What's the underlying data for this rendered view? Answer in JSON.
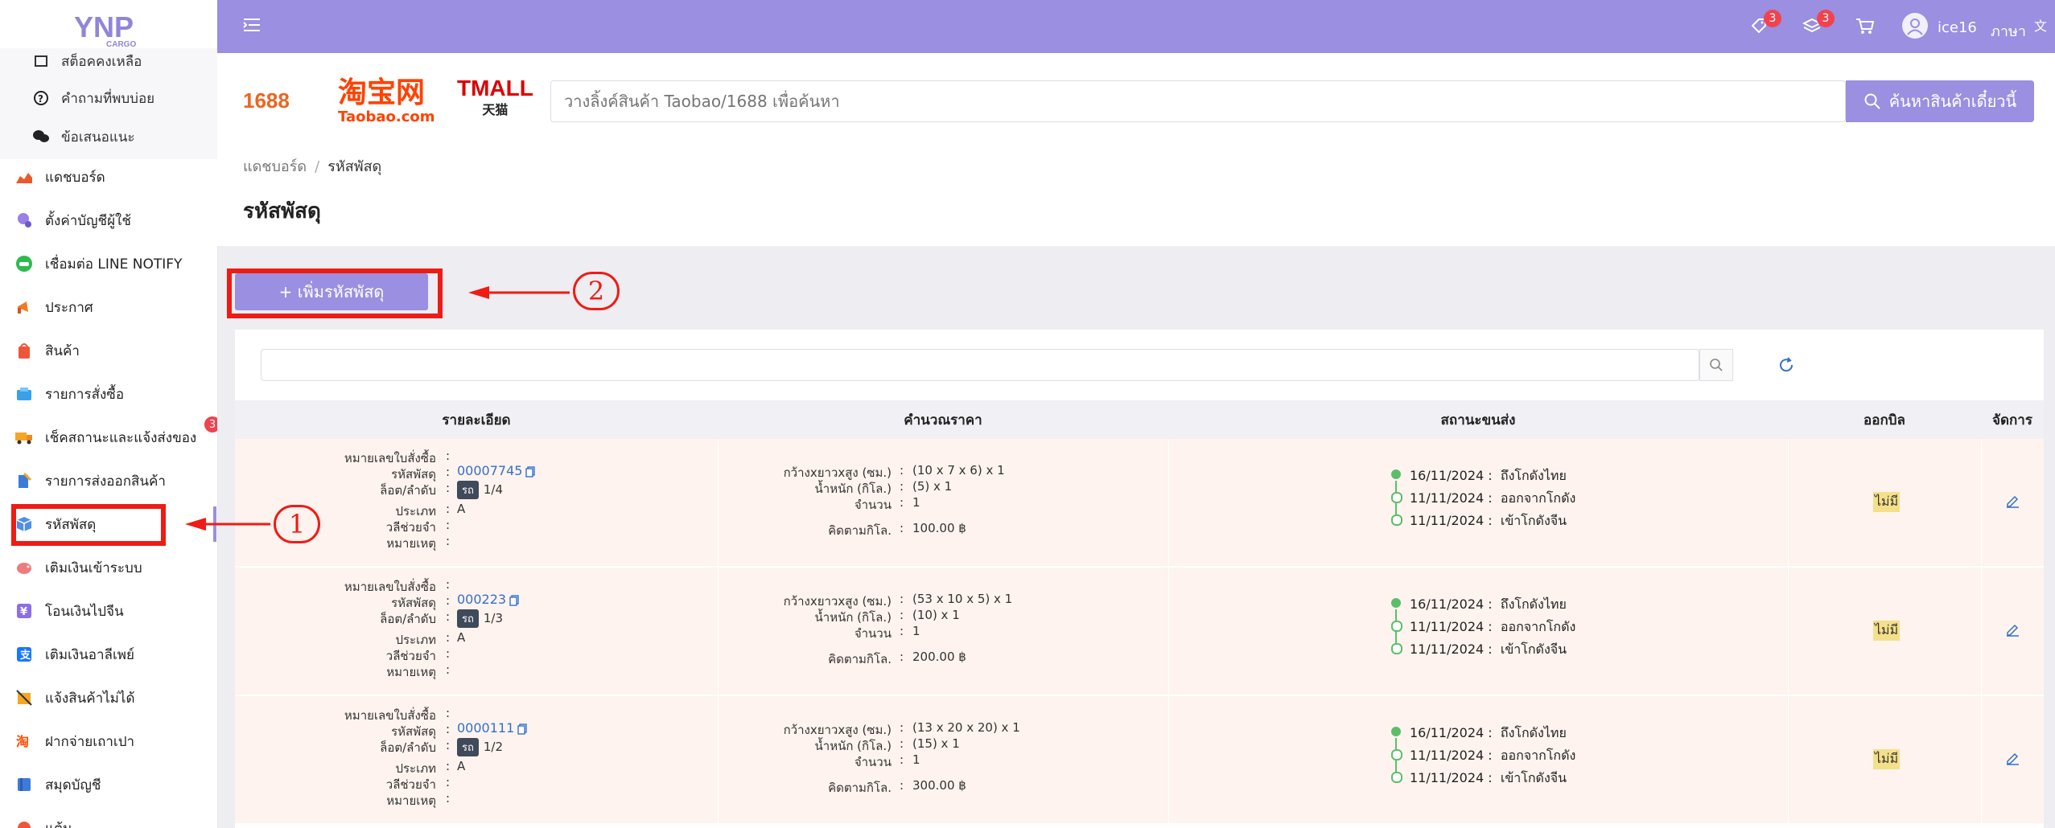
{
  "brand": {
    "logo_text": "YNP",
    "logo_sub": "CARGO"
  },
  "sidebar": {
    "sub_items": [
      {
        "label": "สต็อคคงเหลือ",
        "icon": "stock-icon"
      },
      {
        "label": "คำถามที่พบบ่อย",
        "icon": "question-icon"
      },
      {
        "label": "ข้อเสนอแนะ",
        "icon": "chat-icon"
      }
    ],
    "items": [
      {
        "label": "แดชบอร์ด",
        "icon": "chart-icon"
      },
      {
        "label": "ตั้งค่าบัญชีผู้ใช้",
        "icon": "user-settings-icon"
      },
      {
        "label": "เชื่อมต่อ LINE NOTIFY",
        "icon": "line-icon"
      },
      {
        "label": "ประกาศ",
        "icon": "megaphone-icon"
      },
      {
        "label": "สินค้า",
        "icon": "bag-icon"
      },
      {
        "label": "รายการสั่งซื้อ",
        "icon": "cart-box-icon"
      },
      {
        "label": "เช็คสถานะและแจ้งส่งของ",
        "icon": "truck-icon",
        "badge": "3"
      },
      {
        "label": "รายการส่งออกสินค้า",
        "icon": "export-icon"
      },
      {
        "label": "รหัสพัสดุ",
        "icon": "parcel-icon"
      },
      {
        "label": "เติมเงินเข้าระบบ",
        "icon": "piggy-icon"
      },
      {
        "label": "โอนเงินไปจีน",
        "icon": "yuan-icon"
      },
      {
        "label": "เติมเงินอาลีเพย์",
        "icon": "alipay-icon"
      },
      {
        "label": "แจ้งสินค้าไม่ได้",
        "icon": "no-box-icon"
      },
      {
        "label": "ฝากจ่ายเถาเปา",
        "icon": "taobao-icon"
      },
      {
        "label": "สมุดบัญชี",
        "icon": "book-icon"
      },
      {
        "label": "แต้ม",
        "icon": "points-icon"
      }
    ]
  },
  "topbar": {
    "coupon_badge": "3",
    "stack_badge": "3",
    "username": "ice16",
    "language": "ภาษา"
  },
  "search": {
    "logo_1688": "1688",
    "logo_taobao": "淘宝网",
    "logo_taobao_sub": "Taobao.com",
    "logo_tmall": "TMALL",
    "logo_tmall_sub": "天猫",
    "placeholder": "วางลิ้งค์สินค้า Taobao/1688 เพื่อค้นหา",
    "button": "ค้นหาสินค้าเดี๋ยวนี้"
  },
  "breadcrumb": {
    "home": "แดชบอร์ด",
    "current": "รหัสพัสดุ"
  },
  "page_title": "รหัสพัสดุ",
  "add_button": "+ เพิ่มรหัสพัสดุ",
  "table": {
    "headers": [
      "รายละเอียด",
      "คำนวณราคา",
      "สถานะขนส่ง",
      "ออกบิล",
      "จัดการ"
    ],
    "detail_labels": [
      "หมายเลขใบสั่งซื้อ",
      "รหัสพัสดุ",
      "ล็อต/ลำดับ",
      "ประเภท",
      "วลีช่วยจำ",
      "หมายเหตุ"
    ],
    "price_labels": [
      "กว้างxยาวxสูง (ซม.)",
      "น้ำหนัก (กิโล.)",
      "จำนวน",
      "คิดตามกิโล."
    ],
    "rows": [
      {
        "order_no": "",
        "parcel": "00007745",
        "lot_tag": "รถ",
        "lot": "1/4",
        "type": "A",
        "memo": "",
        "note": "",
        "dims": "(10 x 7 x 6) x 1",
        "weight": "(5) x 1",
        "qty": "1",
        "price": "100.00 ฿",
        "timeline": [
          {
            "date": "16/11/2024",
            "status": "ถึงโกดังไทย"
          },
          {
            "date": "11/11/2024",
            "status": "ออกจากโกดัง"
          },
          {
            "date": "11/11/2024",
            "status": "เข้าโกดังจีน"
          }
        ],
        "bill": "ไม่มี"
      },
      {
        "order_no": "",
        "parcel": "000223",
        "lot_tag": "รถ",
        "lot": "1/3",
        "type": "A",
        "memo": "",
        "note": "",
        "dims": "(53 x 10 x 5) x 1",
        "weight": "(10) x 1",
        "qty": "1",
        "price": "200.00 ฿",
        "timeline": [
          {
            "date": "16/11/2024",
            "status": "ถึงโกดังไทย"
          },
          {
            "date": "11/11/2024",
            "status": "ออกจากโกดัง"
          },
          {
            "date": "11/11/2024",
            "status": "เข้าโกดังจีน"
          }
        ],
        "bill": "ไม่มี"
      },
      {
        "order_no": "",
        "parcel": "0000111",
        "lot_tag": "รถ",
        "lot": "1/2",
        "type": "A",
        "memo": "",
        "note": "",
        "dims": "(13 x 20 x 20) x 1",
        "weight": "(15) x 1",
        "qty": "1",
        "price": "300.00 ฿",
        "timeline": [
          {
            "date": "16/11/2024",
            "status": "ถึงโกดังไทย"
          },
          {
            "date": "11/11/2024",
            "status": "ออกจากโกดัง"
          },
          {
            "date": "11/11/2024",
            "status": "เข้าโกดังจีน"
          }
        ],
        "bill": "ไม่มี"
      }
    ]
  },
  "annotations": {
    "step1": "1",
    "step2": "2"
  },
  "colors": {
    "accent": "#9a8fe0",
    "highlight": "#ee1c14",
    "row_bg": "#fef3ee",
    "timeline": "#5bbf6a"
  }
}
